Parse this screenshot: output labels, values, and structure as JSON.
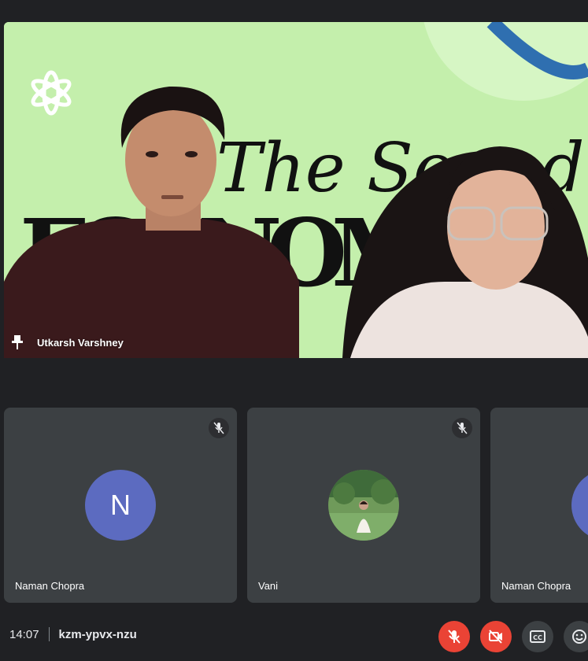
{
  "presenter": {
    "name": "Utkarsh Varshney",
    "background_title_line1": "The Sound of",
    "background_title_line2": "ECONOMICS"
  },
  "participants": [
    {
      "name": "Naman Chopra",
      "initial": "N",
      "muted": true,
      "avatar": "letter"
    },
    {
      "name": "Vani",
      "muted": true,
      "avatar": "photo"
    },
    {
      "name": "Naman Chopra",
      "muted": true,
      "avatar": "letter"
    }
  ],
  "meeting": {
    "time": "14:07",
    "code": "kzm-ypvx-nzu"
  },
  "controls": [
    {
      "name": "mic-off-icon",
      "color": "#ea4335"
    },
    {
      "name": "camera-off-icon",
      "color": "#ea4335"
    },
    {
      "name": "captions-icon",
      "color": "#3c4043"
    },
    {
      "name": "emoji-icon",
      "color": "#3c4043"
    }
  ],
  "colors": {
    "background": "#202124",
    "tile": "#3c4043",
    "avatar": "#5c6bc0",
    "danger": "#ea4335",
    "scene_green": "#c4efac"
  }
}
